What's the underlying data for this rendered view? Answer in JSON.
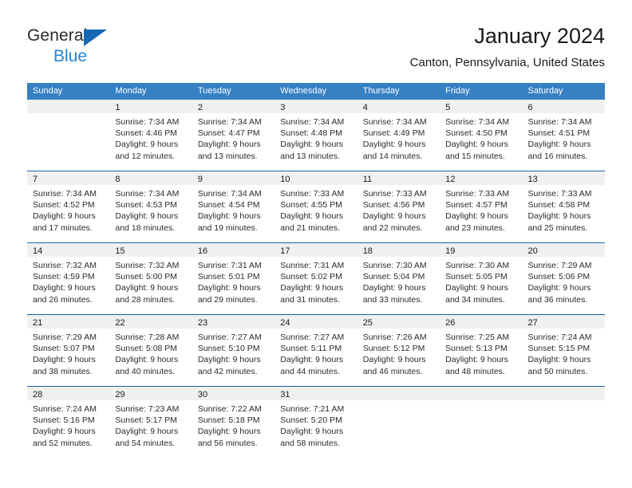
{
  "logo": {
    "word_one": "General",
    "word_two": "Blue",
    "triangle_color": "#1668b3",
    "blue_text_color": "#1f86d8"
  },
  "header": {
    "title": "January 2024",
    "subtitle": "Canton, Pennsylvania, United States"
  },
  "theme": {
    "header_blue": "#3680c4",
    "separator_blue": "#1a63a8",
    "day_band_gray": "#f0f0f0"
  },
  "weekdays": [
    "Sunday",
    "Monday",
    "Tuesday",
    "Wednesday",
    "Thursday",
    "Friday",
    "Saturday"
  ],
  "weeks": [
    [
      {
        "day": "",
        "sunrise": "",
        "sunset": "",
        "daylight_1": "",
        "daylight_2": "",
        "empty": true
      },
      {
        "day": "1",
        "sunrise": "Sunrise: 7:34 AM",
        "sunset": "Sunset: 4:46 PM",
        "daylight_1": "Daylight: 9 hours",
        "daylight_2": "and 12 minutes."
      },
      {
        "day": "2",
        "sunrise": "Sunrise: 7:34 AM",
        "sunset": "Sunset: 4:47 PM",
        "daylight_1": "Daylight: 9 hours",
        "daylight_2": "and 13 minutes."
      },
      {
        "day": "3",
        "sunrise": "Sunrise: 7:34 AM",
        "sunset": "Sunset: 4:48 PM",
        "daylight_1": "Daylight: 9 hours",
        "daylight_2": "and 13 minutes."
      },
      {
        "day": "4",
        "sunrise": "Sunrise: 7:34 AM",
        "sunset": "Sunset: 4:49 PM",
        "daylight_1": "Daylight: 9 hours",
        "daylight_2": "and 14 minutes."
      },
      {
        "day": "5",
        "sunrise": "Sunrise: 7:34 AM",
        "sunset": "Sunset: 4:50 PM",
        "daylight_1": "Daylight: 9 hours",
        "daylight_2": "and 15 minutes."
      },
      {
        "day": "6",
        "sunrise": "Sunrise: 7:34 AM",
        "sunset": "Sunset: 4:51 PM",
        "daylight_1": "Daylight: 9 hours",
        "daylight_2": "and 16 minutes."
      }
    ],
    [
      {
        "day": "7",
        "sunrise": "Sunrise: 7:34 AM",
        "sunset": "Sunset: 4:52 PM",
        "daylight_1": "Daylight: 9 hours",
        "daylight_2": "and 17 minutes."
      },
      {
        "day": "8",
        "sunrise": "Sunrise: 7:34 AM",
        "sunset": "Sunset: 4:53 PM",
        "daylight_1": "Daylight: 9 hours",
        "daylight_2": "and 18 minutes."
      },
      {
        "day": "9",
        "sunrise": "Sunrise: 7:34 AM",
        "sunset": "Sunset: 4:54 PM",
        "daylight_1": "Daylight: 9 hours",
        "daylight_2": "and 19 minutes."
      },
      {
        "day": "10",
        "sunrise": "Sunrise: 7:33 AM",
        "sunset": "Sunset: 4:55 PM",
        "daylight_1": "Daylight: 9 hours",
        "daylight_2": "and 21 minutes."
      },
      {
        "day": "11",
        "sunrise": "Sunrise: 7:33 AM",
        "sunset": "Sunset: 4:56 PM",
        "daylight_1": "Daylight: 9 hours",
        "daylight_2": "and 22 minutes."
      },
      {
        "day": "12",
        "sunrise": "Sunrise: 7:33 AM",
        "sunset": "Sunset: 4:57 PM",
        "daylight_1": "Daylight: 9 hours",
        "daylight_2": "and 23 minutes."
      },
      {
        "day": "13",
        "sunrise": "Sunrise: 7:33 AM",
        "sunset": "Sunset: 4:58 PM",
        "daylight_1": "Daylight: 9 hours",
        "daylight_2": "and 25 minutes."
      }
    ],
    [
      {
        "day": "14",
        "sunrise": "Sunrise: 7:32 AM",
        "sunset": "Sunset: 4:59 PM",
        "daylight_1": "Daylight: 9 hours",
        "daylight_2": "and 26 minutes."
      },
      {
        "day": "15",
        "sunrise": "Sunrise: 7:32 AM",
        "sunset": "Sunset: 5:00 PM",
        "daylight_1": "Daylight: 9 hours",
        "daylight_2": "and 28 minutes."
      },
      {
        "day": "16",
        "sunrise": "Sunrise: 7:31 AM",
        "sunset": "Sunset: 5:01 PM",
        "daylight_1": "Daylight: 9 hours",
        "daylight_2": "and 29 minutes."
      },
      {
        "day": "17",
        "sunrise": "Sunrise: 7:31 AM",
        "sunset": "Sunset: 5:02 PM",
        "daylight_1": "Daylight: 9 hours",
        "daylight_2": "and 31 minutes."
      },
      {
        "day": "18",
        "sunrise": "Sunrise: 7:30 AM",
        "sunset": "Sunset: 5:04 PM",
        "daylight_1": "Daylight: 9 hours",
        "daylight_2": "and 33 minutes."
      },
      {
        "day": "19",
        "sunrise": "Sunrise: 7:30 AM",
        "sunset": "Sunset: 5:05 PM",
        "daylight_1": "Daylight: 9 hours",
        "daylight_2": "and 34 minutes."
      },
      {
        "day": "20",
        "sunrise": "Sunrise: 7:29 AM",
        "sunset": "Sunset: 5:06 PM",
        "daylight_1": "Daylight: 9 hours",
        "daylight_2": "and 36 minutes."
      }
    ],
    [
      {
        "day": "21",
        "sunrise": "Sunrise: 7:29 AM",
        "sunset": "Sunset: 5:07 PM",
        "daylight_1": "Daylight: 9 hours",
        "daylight_2": "and 38 minutes."
      },
      {
        "day": "22",
        "sunrise": "Sunrise: 7:28 AM",
        "sunset": "Sunset: 5:08 PM",
        "daylight_1": "Daylight: 9 hours",
        "daylight_2": "and 40 minutes."
      },
      {
        "day": "23",
        "sunrise": "Sunrise: 7:27 AM",
        "sunset": "Sunset: 5:10 PM",
        "daylight_1": "Daylight: 9 hours",
        "daylight_2": "and 42 minutes."
      },
      {
        "day": "24",
        "sunrise": "Sunrise: 7:27 AM",
        "sunset": "Sunset: 5:11 PM",
        "daylight_1": "Daylight: 9 hours",
        "daylight_2": "and 44 minutes."
      },
      {
        "day": "25",
        "sunrise": "Sunrise: 7:26 AM",
        "sunset": "Sunset: 5:12 PM",
        "daylight_1": "Daylight: 9 hours",
        "daylight_2": "and 46 minutes."
      },
      {
        "day": "26",
        "sunrise": "Sunrise: 7:25 AM",
        "sunset": "Sunset: 5:13 PM",
        "daylight_1": "Daylight: 9 hours",
        "daylight_2": "and 48 minutes."
      },
      {
        "day": "27",
        "sunrise": "Sunrise: 7:24 AM",
        "sunset": "Sunset: 5:15 PM",
        "daylight_1": "Daylight: 9 hours",
        "daylight_2": "and 50 minutes."
      }
    ],
    [
      {
        "day": "28",
        "sunrise": "Sunrise: 7:24 AM",
        "sunset": "Sunset: 5:16 PM",
        "daylight_1": "Daylight: 9 hours",
        "daylight_2": "and 52 minutes."
      },
      {
        "day": "29",
        "sunrise": "Sunrise: 7:23 AM",
        "sunset": "Sunset: 5:17 PM",
        "daylight_1": "Daylight: 9 hours",
        "daylight_2": "and 54 minutes."
      },
      {
        "day": "30",
        "sunrise": "Sunrise: 7:22 AM",
        "sunset": "Sunset: 5:18 PM",
        "daylight_1": "Daylight: 9 hours",
        "daylight_2": "and 56 minutes."
      },
      {
        "day": "31",
        "sunrise": "Sunrise: 7:21 AM",
        "sunset": "Sunset: 5:20 PM",
        "daylight_1": "Daylight: 9 hours",
        "daylight_2": "and 58 minutes."
      },
      {
        "day": "",
        "sunrise": "",
        "sunset": "",
        "daylight_1": "",
        "daylight_2": "",
        "empty": true
      },
      {
        "day": "",
        "sunrise": "",
        "sunset": "",
        "daylight_1": "",
        "daylight_2": "",
        "empty": true
      },
      {
        "day": "",
        "sunrise": "",
        "sunset": "",
        "daylight_1": "",
        "daylight_2": "",
        "empty": true
      }
    ]
  ]
}
